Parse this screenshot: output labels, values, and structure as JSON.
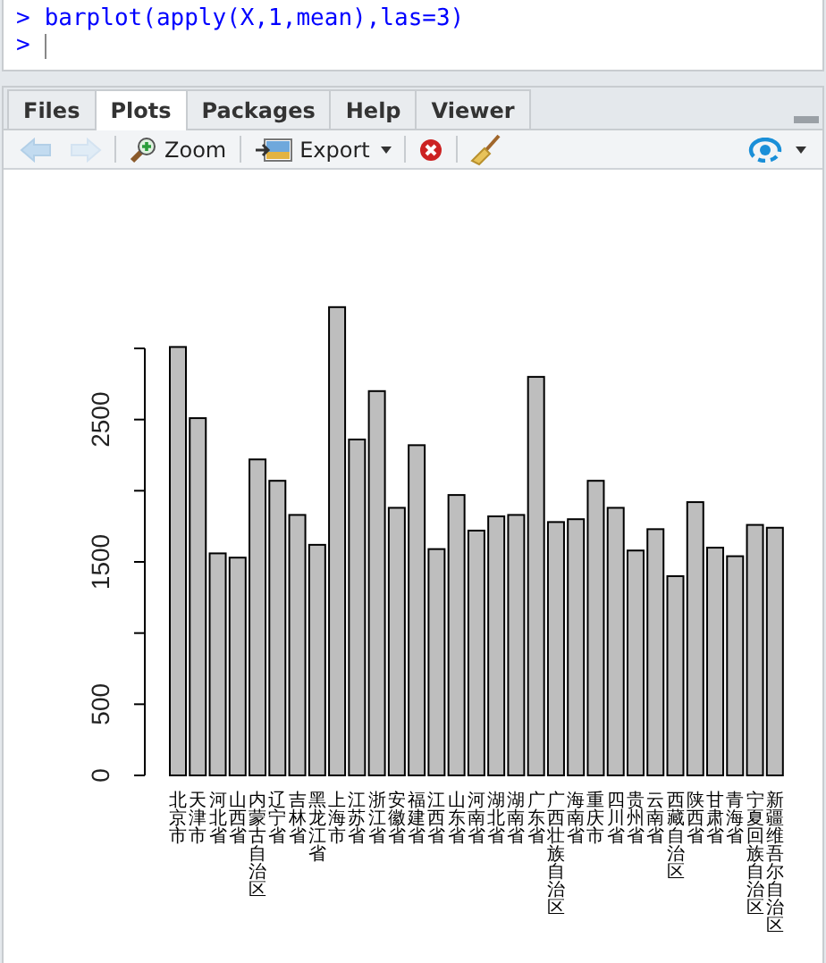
{
  "console": {
    "prompt": ">",
    "command": "barplot(apply(X,1,mean),las=3)",
    "input_prompt": ">"
  },
  "tabs": [
    {
      "label": "Files",
      "selected": false
    },
    {
      "label": "Plots",
      "selected": true
    },
    {
      "label": "Packages",
      "selected": false
    },
    {
      "label": "Help",
      "selected": false
    },
    {
      "label": "Viewer",
      "selected": false
    }
  ],
  "toolbar": [
    {
      "kind": "back",
      "disabled": true
    },
    {
      "kind": "forward",
      "disabled": true
    },
    {
      "kind": "zoom",
      "label": "Zoom"
    },
    {
      "kind": "export",
      "label": "Export"
    },
    {
      "kind": "remove"
    },
    {
      "kind": "clear"
    },
    {
      "kind": "publish"
    }
  ],
  "plot": {
    "chart_data": {
      "type": "bar",
      "categories": [
        "北京市",
        "天津市",
        "河北省",
        "山西省",
        "内蒙古自治区",
        "辽宁省",
        "吉林省",
        "黑龙江省",
        "上海市",
        "江苏省",
        "浙江省",
        "安徽省",
        "福建省",
        "江西省",
        "山东省",
        "河南省",
        "湖北省",
        "湖南省",
        "广东省",
        "广西壮族自治区",
        "海南省",
        "重庆市",
        "四川省",
        "贵州省",
        "云南省",
        "西藏自治区",
        "陕西省",
        "甘肃省",
        "青海省",
        "宁夏回族自治区",
        "新疆维吾尔自治区"
      ],
      "values": [
        3010,
        2510,
        1560,
        1530,
        2220,
        2070,
        1830,
        1620,
        3290,
        2360,
        2700,
        1880,
        2320,
        1590,
        1970,
        1720,
        1820,
        1830,
        2800,
        1780,
        1800,
        2070,
        1880,
        1580,
        1730,
        1400,
        1920,
        1600,
        1540,
        1760,
        1740
      ],
      "ylim": [
        0,
        3300
      ],
      "yticks": [
        0,
        500,
        1500,
        2500
      ]
    }
  }
}
